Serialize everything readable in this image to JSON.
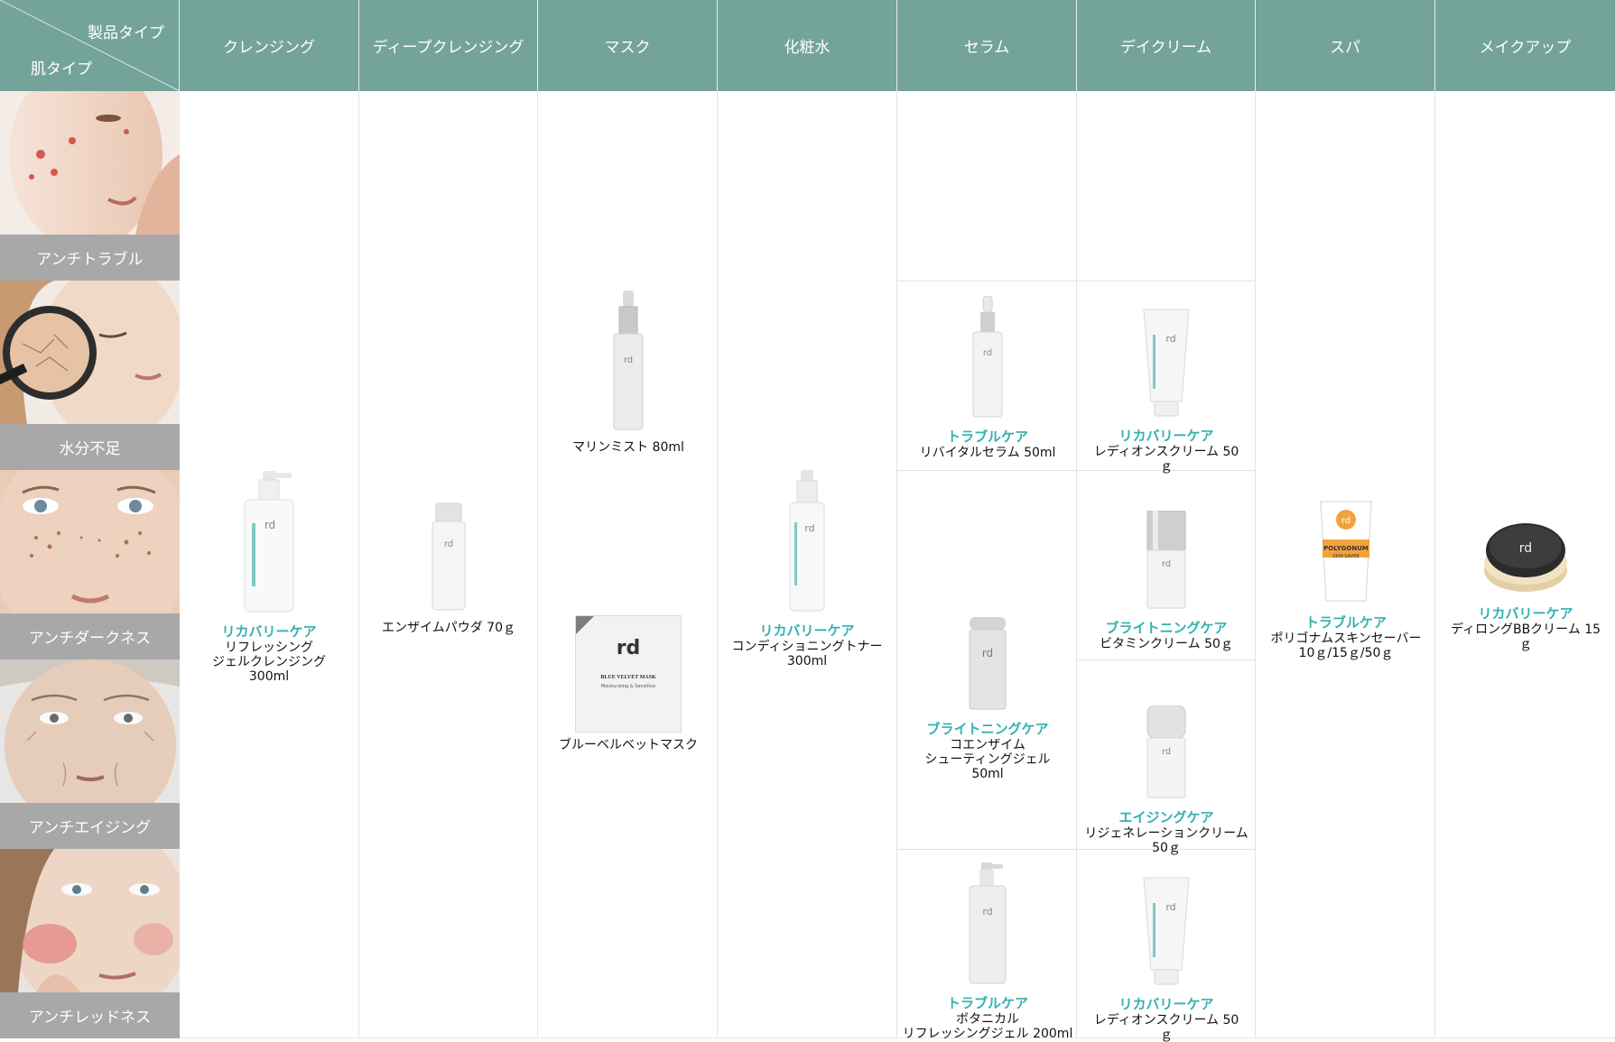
{
  "header": {
    "product_type_label": "製品タイプ",
    "skin_type_label": "肌タイプ",
    "columns": [
      "クレンジング",
      "ディープクレンジング",
      "マスク",
      "化粧水",
      "セラム",
      "デイクリーム",
      "スパ",
      "メイクアップ"
    ]
  },
  "skin_types": [
    "アンチトラブル",
    "水分不足",
    "アンチダークネス",
    "アンチエイジング",
    "アンチレッドネス"
  ],
  "products": {
    "cleansing": {
      "category": "リカバリーケア",
      "name": "リフレッシング\nジェルクレンジング\n300ml"
    },
    "deep_cleansing": {
      "category": "",
      "name": "エンザイムパウダ 70ｇ"
    },
    "mask_mist": {
      "category": "",
      "name": "マリンミスト 80ml"
    },
    "mask_velvet": {
      "category": "",
      "name": "ブルーベルベットマスク",
      "package_title": "BLUE VELVET MASK",
      "package_subtitle": "Moisturizing & Sensitive"
    },
    "toner": {
      "category": "リカバリーケア",
      "name": "コンディショニングトナー\n300ml"
    },
    "serum_revital": {
      "category": "トラブルケア",
      "name": "リバイタルセラム 50ml"
    },
    "serum_coenzyme": {
      "category": "ブライトニングケア",
      "name": "コエンザイム\nシューティングジェル\n50ml"
    },
    "serum_botanical": {
      "category": "トラブルケア",
      "name": "ボタニカル\nリフレッシングジェル 200ml"
    },
    "day_radion1": {
      "category": "リカバリーケア",
      "name": "レディオンスクリーム 50ｇ"
    },
    "day_vitamin": {
      "category": "ブライトニングケア",
      "name": "ビタミンクリーム 50ｇ"
    },
    "day_regen": {
      "category": "エイジングケア",
      "name": "リジェネレーションクリーム 50ｇ"
    },
    "day_radion2": {
      "category": "リカバリーケア",
      "name": "レディオンスクリーム 50ｇ"
    },
    "spa": {
      "category": "トラブルケア",
      "name": "ポリゴナムスキンセーバー\n10ｇ/15ｇ/50ｇ",
      "package_title": "POLYGONUM",
      "package_subtitle": "SKIN SAVER"
    },
    "makeup": {
      "category": "リカバリーケア",
      "name": "ディロングBBクリーム 15ｇ"
    }
  },
  "colors": {
    "header_bg": "#74a39a",
    "category_text": "#34b0b0",
    "skin_label_bg": "#a8a8a8"
  }
}
